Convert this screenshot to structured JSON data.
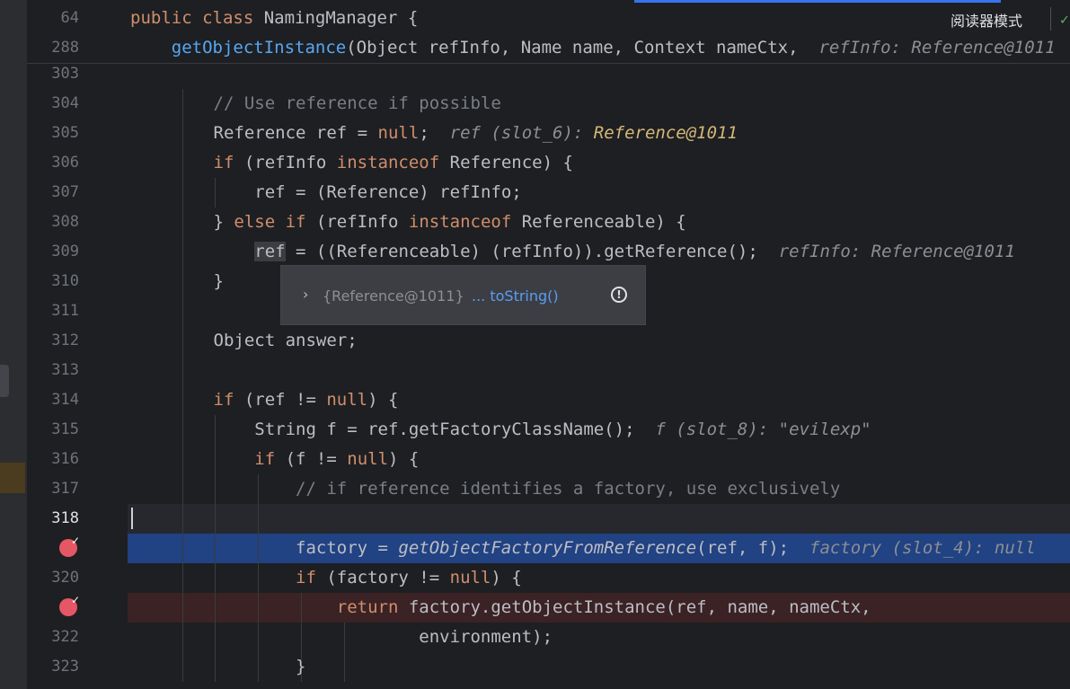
{
  "sticky": [
    {
      "num": "64",
      "indent": "",
      "parts": [
        {
          "t": "public class ",
          "c": "kw"
        },
        {
          "t": "NamingManager {",
          "c": ""
        }
      ]
    },
    {
      "num": "288",
      "indent": "    ",
      "parts": [
        {
          "t": "getObjectInstance",
          "c": "fn"
        },
        {
          "t": "(Object refInfo, Name name, Context nameCtx,  ",
          "c": ""
        },
        {
          "t": "refInfo: Reference@1011",
          "c": "hint"
        }
      ]
    }
  ],
  "reader_mode": {
    "label": "阅读器模式"
  },
  "lines": [
    {
      "num": "303",
      "indent": "",
      "parts": []
    },
    {
      "num": "304",
      "indent": "        ",
      "parts": [
        {
          "t": "// Use reference if possible",
          "c": "cm"
        }
      ]
    },
    {
      "num": "305",
      "indent": "        ",
      "parts": [
        {
          "t": "Reference ref = ",
          "c": ""
        },
        {
          "t": "null",
          "c": "kw"
        },
        {
          "t": ";  ",
          "c": ""
        },
        {
          "t": "ref (slot_6): ",
          "c": "hint"
        },
        {
          "t": "Reference@1011",
          "c": "hint-y"
        }
      ]
    },
    {
      "num": "306",
      "indent": "        ",
      "parts": [
        {
          "t": "if",
          "c": "kw"
        },
        {
          "t": " (refInfo ",
          "c": ""
        },
        {
          "t": "instanceof",
          "c": "kw"
        },
        {
          "t": " Reference) {",
          "c": ""
        }
      ]
    },
    {
      "num": "307",
      "indent": "            ",
      "parts": [
        {
          "t": "ref = (Reference) refInfo;",
          "c": ""
        }
      ]
    },
    {
      "num": "308",
      "indent": "        ",
      "parts": [
        {
          "t": "} ",
          "c": ""
        },
        {
          "t": "else if",
          "c": "kw"
        },
        {
          "t": " (refInfo ",
          "c": ""
        },
        {
          "t": "instanceof",
          "c": "kw"
        },
        {
          "t": " Referenceable) {",
          "c": ""
        }
      ]
    },
    {
      "num": "309",
      "indent": "            ",
      "parts": [
        {
          "t": "ref",
          "c": "ref-hl"
        },
        {
          "t": " = ((Referenceable) (refInfo)).getReference();  ",
          "c": ""
        },
        {
          "t": "refInfo: Reference@1011",
          "c": "hint"
        }
      ]
    },
    {
      "num": "310",
      "indent": "        ",
      "parts": [
        {
          "t": "}",
          "c": ""
        }
      ]
    },
    {
      "num": "311",
      "indent": "",
      "parts": []
    },
    {
      "num": "312",
      "indent": "        ",
      "parts": [
        {
          "t": "Object answer;",
          "c": ""
        }
      ]
    },
    {
      "num": "313",
      "indent": "",
      "parts": []
    },
    {
      "num": "314",
      "indent": "        ",
      "parts": [
        {
          "t": "if",
          "c": "kw"
        },
        {
          "t": " (ref != ",
          "c": ""
        },
        {
          "t": "null",
          "c": "kw"
        },
        {
          "t": ") {",
          "c": ""
        }
      ]
    },
    {
      "num": "315",
      "indent": "            ",
      "parts": [
        {
          "t": "String f = ref.getFactoryClassName();  ",
          "c": ""
        },
        {
          "t": "f (slot_8): \"evilexp\"",
          "c": "hint"
        }
      ]
    },
    {
      "num": "316",
      "indent": "            ",
      "parts": [
        {
          "t": "if",
          "c": "kw"
        },
        {
          "t": " (f != ",
          "c": ""
        },
        {
          "t": "null",
          "c": "kw"
        },
        {
          "t": ") {",
          "c": ""
        }
      ]
    },
    {
      "num": "317",
      "indent": "                ",
      "parts": [
        {
          "t": "// if reference identifies a factory, use exclusively",
          "c": "cm"
        }
      ]
    },
    {
      "num": "318",
      "indent": "",
      "parts": []
    },
    {
      "num": "",
      "indent": "                ",
      "parts": [
        {
          "t": "factory = ",
          "c": ""
        },
        {
          "t": "getObjectFactoryFromReference",
          "c": "mi"
        },
        {
          "t": "(ref, f);  ",
          "c": ""
        },
        {
          "t": "factory (slot_4): null",
          "c": "hint"
        }
      ]
    },
    {
      "num": "320",
      "indent": "                ",
      "parts": [
        {
          "t": "if",
          "c": "kw"
        },
        {
          "t": " (factory != ",
          "c": ""
        },
        {
          "t": "null",
          "c": "kw"
        },
        {
          "t": ") {",
          "c": ""
        }
      ]
    },
    {
      "num": "",
      "indent": "                    ",
      "parts": [
        {
          "t": "return",
          "c": "kw"
        },
        {
          "t": " factory.getObjectInstance(ref, name, nameCtx,",
          "c": ""
        }
      ]
    },
    {
      "num": "322",
      "indent": "                            ",
      "parts": [
        {
          "t": "environment);",
          "c": ""
        }
      ]
    },
    {
      "num": "323",
      "indent": "                ",
      "parts": [
        {
          "t": "}",
          "c": ""
        }
      ]
    }
  ],
  "popup": {
    "object": "{Reference@1011}",
    "link": "... toString()"
  }
}
